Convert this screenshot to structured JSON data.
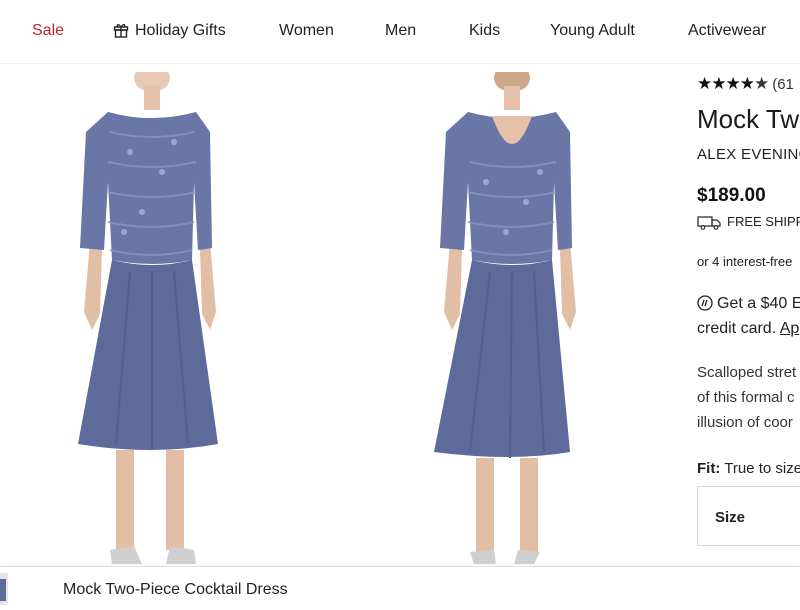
{
  "nav": {
    "items": [
      "Sale",
      "Holiday Gifts",
      "Women",
      "Men",
      "Kids",
      "Young Adult",
      "Activewear"
    ],
    "gift_icon": "gift-icon",
    "sale_color": "#c0262d"
  },
  "gallery": {
    "images": [
      "dress-front-view",
      "dress-back-view"
    ],
    "dress_color": "#5d6a9a"
  },
  "product": {
    "rating_stars": 4.5,
    "review_count": "(61",
    "title": "Mock Two",
    "brand": "ALEX EVENING",
    "price": "$189.00",
    "shipping_text": "FREE SHIPPI",
    "installments_text": "or 4 interest-free",
    "promo_line1": "Get a $40 E",
    "promo_line2": "credit card.",
    "promo_link": "Ap",
    "description": [
      "Scalloped stret",
      "of this formal c",
      "illusion of coor"
    ],
    "fit_label": "Fit:",
    "fit_value": "True to size",
    "size_label": "Size"
  },
  "sticky": {
    "title": "Mock Two-Piece Cocktail Dress"
  }
}
